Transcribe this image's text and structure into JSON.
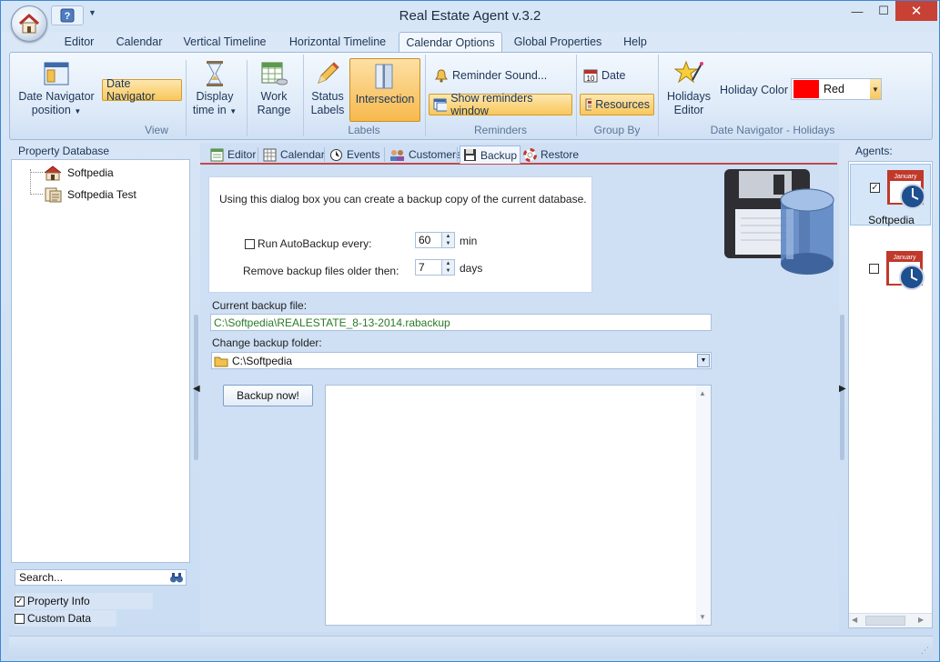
{
  "window": {
    "title": "Real Estate Agent v.3.2"
  },
  "ribbon": {
    "tabs": [
      "Editor",
      "Calendar",
      "Vertical Timeline",
      "Horizontal Timeline",
      "Calendar Options",
      "Global Properties",
      "Help"
    ],
    "active_tab": "Calendar Options",
    "groups": {
      "view": {
        "label": "View",
        "date_nav_position": "Date Navigator position",
        "date_navigator": "Date Navigator",
        "display_time_in": "Display time in",
        "work_range": "Work Range"
      },
      "labels": {
        "label": "Labels",
        "status_labels": "Status Labels",
        "intersection": "Intersection"
      },
      "reminders": {
        "label": "Reminders",
        "reminder_sound": "Reminder Sound...",
        "show_reminders_window": "Show reminders window"
      },
      "group_by": {
        "label": "Group By",
        "date": "Date",
        "resources": "Resources"
      },
      "holidays": {
        "label": "Date Navigator - Holidays",
        "holidays_editor": "Holidays Editor",
        "holiday_color_label": "Holiday Color",
        "holiday_color_value": "Red",
        "holiday_color_hex": "#ff0000"
      }
    }
  },
  "left_panel": {
    "header": "Property Database",
    "tree": [
      "Softpedia",
      "Softpedia Test"
    ],
    "search_placeholder": "Search...",
    "checkboxes": [
      {
        "label": "Property Info",
        "checked": true
      },
      {
        "label": "Custom Data",
        "checked": false
      }
    ]
  },
  "center": {
    "tabs": [
      "Editor",
      "Calendar",
      "Events",
      "Customers",
      "Backup",
      "Restore"
    ],
    "active_tab": "Backup",
    "info_text": "Using this dialog box you can create a backup copy of the current database.",
    "autobackup_label": "Run AutoBackup every:",
    "autobackup_checked": false,
    "autobackup_value": "60",
    "autobackup_unit": "min",
    "remove_label": "Remove backup files older then:",
    "remove_value": "7",
    "remove_unit": "days",
    "current_file_label": "Current backup file:",
    "current_file_value": "C:\\Softpedia\\REALESTATE_8-13-2014.rabackup",
    "change_folder_label": "Change backup folder:",
    "change_folder_value": "C:\\Softpedia",
    "backup_button": "Backup now!"
  },
  "right_panel": {
    "header": "Agents:",
    "agents": [
      {
        "name": "Softpedia",
        "checked": true,
        "calendar_month": "January"
      },
      {
        "name": "",
        "checked": false,
        "calendar_month": "January"
      }
    ]
  }
}
